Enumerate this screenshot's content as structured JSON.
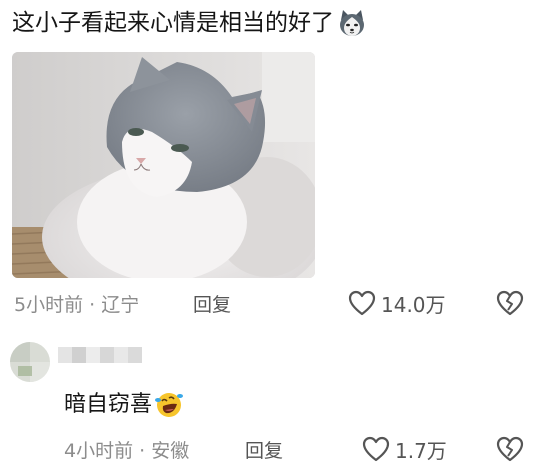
{
  "comment": {
    "text": "这小子看起来心情是相当的好了",
    "emoji": "husky-emoji",
    "image": "cat-photo",
    "time_location": "5小时前 · 辽宁",
    "reply_label": "回复",
    "likes": "14.0万",
    "like_icon": "heart-outline-icon",
    "dislike_icon": "broken-heart-icon"
  },
  "reply": {
    "avatar": "avatar-icon",
    "text": "暗自窃喜",
    "emoji": "laughing-crying-emoji",
    "time_location": "4小时前 · 安徽",
    "reply_label": "回复",
    "likes": "1.7万",
    "like_icon": "heart-outline-icon",
    "dislike_icon": "broken-heart-icon"
  },
  "colors": {
    "text": "#161616",
    "meta": "#8c8c8c",
    "action": "#555555"
  }
}
